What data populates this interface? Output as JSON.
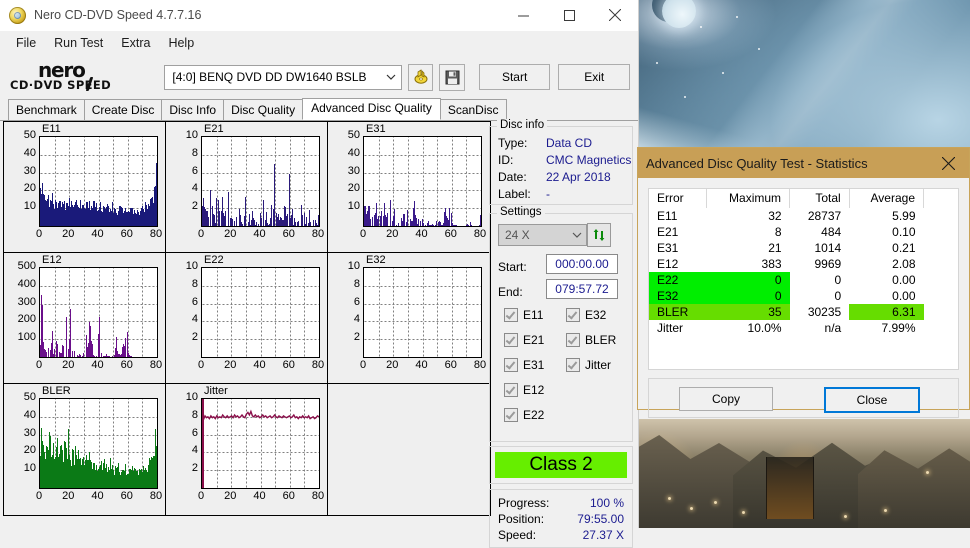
{
  "window": {
    "title": "Nero CD-DVD Speed 4.7.7.16",
    "icon": "nero-disc-icon",
    "minimize": "minimize-icon",
    "maximize": "maximize-icon",
    "close": "close-icon"
  },
  "menu": [
    "File",
    "Run Test",
    "Extra",
    "Help"
  ],
  "logo": {
    "brand": "nero",
    "sub": "CD·DVD  SPEED"
  },
  "toolbar": {
    "drive": "[4:0]   BENQ DVD DD DW1640 BSLB",
    "eject_icon": "disc-eject-icon",
    "save_icon": "floppy-save-icon",
    "start": "Start",
    "exit": "Exit"
  },
  "tabs": [
    {
      "label": "Benchmark",
      "active": false
    },
    {
      "label": "Create Disc",
      "active": false
    },
    {
      "label": "Disc Info",
      "active": false
    },
    {
      "label": "Disc Quality",
      "active": false
    },
    {
      "label": "Advanced Disc Quality",
      "active": true
    },
    {
      "label": "ScanDisc",
      "active": false
    }
  ],
  "disc_info": {
    "caption": "Disc info",
    "type_label": "Type:",
    "type_value": "Data CD",
    "id_label": "ID:",
    "id_value": "CMC Magnetics",
    "date_label": "Date:",
    "date_value": "22 Apr 2018",
    "label_label": "Label:",
    "label_value": "-"
  },
  "settings": {
    "caption": "Settings",
    "speed": "24 X",
    "refresh_icon": "refresh-icon",
    "start_label": "Start:",
    "start_value": "000:00.00",
    "end_label": "End:",
    "end_value": "079:57.72",
    "checks_left": [
      "E11",
      "E21",
      "E31",
      "E12",
      "E22"
    ],
    "checks_right": [
      "E32",
      "BLER",
      "Jitter"
    ]
  },
  "class": {
    "text": "Class 2",
    "color": "#66ee00"
  },
  "progress": {
    "progress_label": "Progress:",
    "progress_value": "100 %",
    "position_label": "Position:",
    "position_value": "79:55.00",
    "speed_label": "Speed:",
    "speed_value": "27.37 X"
  },
  "dialog": {
    "title": "Advanced Disc Quality Test - Statistics",
    "close_icon": "close-icon",
    "headers": [
      "Error",
      "Maximum",
      "Total",
      "Average"
    ],
    "rows": [
      {
        "error": "E11",
        "maximum": "32",
        "total": "28737",
        "average": "5.99",
        "highlight": "none"
      },
      {
        "error": "E21",
        "maximum": "8",
        "total": "484",
        "average": "0.10",
        "highlight": "none"
      },
      {
        "error": "E31",
        "maximum": "21",
        "total": "1014",
        "average": "0.21",
        "highlight": "none"
      },
      {
        "error": "E12",
        "maximum": "383",
        "total": "9969",
        "average": "2.08",
        "highlight": "none"
      },
      {
        "error": "E22",
        "maximum": "0",
        "total": "0",
        "average": "0.00",
        "highlight": "green"
      },
      {
        "error": "E32",
        "maximum": "0",
        "total": "0",
        "average": "0.00",
        "highlight": "green"
      },
      {
        "error": "BLER",
        "maximum": "35",
        "total": "30235",
        "average": "6.31",
        "highlight": "ltgreen"
      },
      {
        "error": "Jitter",
        "maximum": "10.0%",
        "total": "n/a",
        "average": "7.99%",
        "highlight": "none"
      }
    ],
    "copy": "Copy",
    "close": "Close",
    "colors": {
      "green": "#00ee00",
      "ltgreen": "#66dd00",
      "titlebar": "#c89f56"
    }
  },
  "chart_data": [
    {
      "type": "area",
      "name": "E11",
      "title": "E11",
      "color": "#1a1a7a",
      "xlabel": "",
      "ylabel": "",
      "xlim": [
        0,
        80
      ],
      "ylim": [
        0,
        50
      ],
      "xticks": [
        0,
        20,
        40,
        60,
        80
      ],
      "yticks": [
        10,
        20,
        30,
        40,
        50
      ],
      "grid": true,
      "values": [
        18,
        22,
        16,
        14,
        13,
        15,
        12,
        14,
        16,
        13,
        12,
        14,
        13,
        15,
        12,
        13,
        14,
        12,
        13,
        15,
        12,
        11,
        13,
        12,
        14,
        11,
        12,
        13,
        11,
        12,
        13,
        11,
        12,
        14,
        11,
        10,
        12,
        11,
        13,
        10,
        11,
        12,
        10,
        11,
        9,
        10,
        11,
        9,
        10,
        11,
        9,
        10,
        9,
        8,
        10,
        9,
        8,
        9,
        10,
        8,
        9,
        8,
        9,
        8,
        9,
        8,
        9,
        8,
        9,
        10,
        9,
        10,
        11,
        12,
        13,
        14,
        16,
        18,
        21,
        28
      ]
    },
    {
      "type": "bar",
      "name": "E21",
      "title": "E21",
      "color": "#2a1a7a",
      "xlim": [
        0,
        80
      ],
      "ylim": [
        0,
        10
      ],
      "xticks": [
        0,
        20,
        40,
        60,
        80
      ],
      "yticks": [
        2,
        4,
        6,
        8,
        10
      ],
      "grid": true,
      "values": [
        4,
        2,
        2,
        3,
        1,
        7,
        2,
        3,
        2,
        1,
        7,
        4,
        1,
        2,
        4,
        2,
        2,
        2,
        4,
        2,
        1,
        0,
        2,
        1,
        0,
        2,
        1,
        0,
        1,
        5,
        2,
        0,
        1,
        0,
        2,
        1,
        0,
        1,
        0,
        2,
        1,
        0,
        5,
        1,
        2,
        0,
        1,
        4,
        0,
        6,
        8,
        2,
        1,
        2,
        1,
        0,
        4,
        2,
        1,
        6,
        1,
        2,
        0,
        1,
        0,
        2,
        0,
        1,
        4,
        2,
        0,
        1,
        0,
        2,
        1,
        0,
        2,
        1,
        0,
        1
      ]
    },
    {
      "type": "bar",
      "name": "E31",
      "title": "E31",
      "color": "#3a1a8a",
      "xlim": [
        0,
        80
      ],
      "ylim": [
        0,
        50
      ],
      "xticks": [
        0,
        20,
        40,
        60,
        80
      ],
      "yticks": [
        10,
        20,
        30,
        40,
        50
      ],
      "grid": true,
      "values": [
        20,
        5,
        8,
        21,
        6,
        3,
        9,
        8,
        20,
        11,
        5,
        9,
        12,
        6,
        17,
        9,
        8,
        11,
        14,
        6,
        9,
        4,
        1,
        0,
        8,
        5,
        2,
        9,
        3,
        11,
        13,
        4,
        2,
        7,
        17,
        5,
        2,
        8,
        3,
        6,
        2,
        0,
        1,
        4,
        2,
        0,
        3,
        1,
        0,
        2,
        9,
        6,
        1,
        0,
        3,
        9,
        8,
        5,
        9,
        7,
        2,
        0,
        1,
        0,
        0,
        0,
        0,
        0,
        0,
        0,
        1,
        0,
        3,
        0,
        0,
        0,
        0,
        0,
        0,
        5
      ]
    },
    {
      "type": "bar",
      "name": "E12",
      "title": "E12",
      "color": "#6a0f8a",
      "xlim": [
        0,
        80
      ],
      "ylim": [
        0,
        500
      ],
      "xticks": [
        0,
        20,
        40,
        60,
        80
      ],
      "yticks": [
        100,
        200,
        300,
        400,
        500
      ],
      "grid": true,
      "values": [
        120,
        380,
        90,
        60,
        40,
        80,
        35,
        50,
        240,
        30,
        90,
        140,
        60,
        30,
        20,
        130,
        40,
        160,
        215,
        80,
        170,
        210,
        60,
        30,
        20,
        10,
        5,
        20,
        0,
        5,
        95,
        130,
        40,
        205,
        215,
        90,
        20,
        10,
        5,
        20,
        250,
        30,
        10,
        0,
        5,
        20,
        0,
        5,
        0,
        0,
        10,
        100,
        110,
        30,
        20,
        0,
        100,
        100,
        90,
        140,
        30,
        5,
        0,
        0,
        0,
        0,
        0,
        0,
        0,
        0,
        0,
        0,
        0,
        0,
        0,
        0,
        0,
        0,
        0,
        0
      ]
    },
    {
      "type": "bar",
      "name": "E22",
      "title": "E22",
      "color": "#1a1a7a",
      "xlim": [
        0,
        80
      ],
      "ylim": [
        0,
        10
      ],
      "xticks": [
        0,
        20,
        40,
        60,
        80
      ],
      "yticks": [
        2,
        4,
        6,
        8,
        10
      ],
      "grid": true,
      "values": []
    },
    {
      "type": "bar",
      "name": "E32",
      "title": "E32",
      "color": "#1a1a7a",
      "xlim": [
        0,
        80
      ],
      "ylim": [
        0,
        10
      ],
      "xticks": [
        0,
        20,
        40,
        60,
        80
      ],
      "yticks": [
        2,
        4,
        6,
        8,
        10
      ],
      "grid": true,
      "values": []
    },
    {
      "type": "area",
      "name": "BLER",
      "title": "BLER",
      "color": "#0b7a16",
      "xlim": [
        0,
        80
      ],
      "ylim": [
        0,
        50
      ],
      "xticks": [
        0,
        20,
        40,
        60,
        80
      ],
      "yticks": [
        10,
        20,
        30,
        40,
        50
      ],
      "grid": true,
      "values": [
        22,
        33,
        20,
        18,
        24,
        21,
        35,
        27,
        20,
        23,
        19,
        26,
        21,
        17,
        22,
        18,
        20,
        24,
        18,
        29,
        17,
        15,
        19,
        16,
        20,
        14,
        18,
        16,
        15,
        20,
        14,
        16,
        13,
        18,
        14,
        13,
        16,
        12,
        15,
        13,
        11,
        14,
        12,
        16,
        11,
        13,
        10,
        12,
        14,
        11,
        9,
        12,
        10,
        13,
        11,
        9,
        12,
        10,
        11,
        9,
        10,
        9,
        11,
        10,
        9,
        11,
        10,
        9,
        11,
        10,
        12,
        11,
        13,
        12,
        14,
        16,
        18,
        21,
        26,
        31
      ]
    },
    {
      "type": "line",
      "name": "Jitter",
      "title": "Jitter",
      "color": "#8a0f4a",
      "xlim": [
        0,
        80
      ],
      "ylim": [
        0,
        10
      ],
      "xticks": [
        0,
        20,
        40,
        60,
        80
      ],
      "yticks": [
        2,
        4,
        6,
        8,
        10
      ],
      "grid": true,
      "values": [
        7.9,
        7.7,
        8.1,
        7.9,
        8.0,
        7.8,
        8.1,
        7.9,
        8.0,
        7.8,
        8.1,
        7.9,
        8.0,
        7.9,
        8.2,
        8.0,
        7.9,
        8.1,
        7.9,
        8.0,
        8.1,
        7.9,
        8.2,
        8.0,
        8.1,
        7.9,
        8.0,
        8.2,
        8.0,
        7.9,
        8.3,
        8.5,
        8.2,
        8.6,
        8.1,
        8.0,
        8.2,
        8.0,
        8.1,
        7.9,
        8.0,
        8.2,
        8.0,
        8.1,
        7.9,
        8.0,
        8.1,
        7.9,
        8.0,
        8.2,
        8.0,
        7.9,
        8.1,
        8.0,
        7.9,
        8.1,
        8.0,
        7.9,
        8.0,
        8.1,
        7.9,
        8.0,
        8.2,
        7.9,
        8.0,
        7.8,
        8.0,
        7.9,
        8.1,
        7.9,
        8.0,
        7.9,
        8.1,
        7.8,
        7.9,
        8.0,
        7.8,
        7.9,
        8.1,
        8.0
      ]
    }
  ]
}
